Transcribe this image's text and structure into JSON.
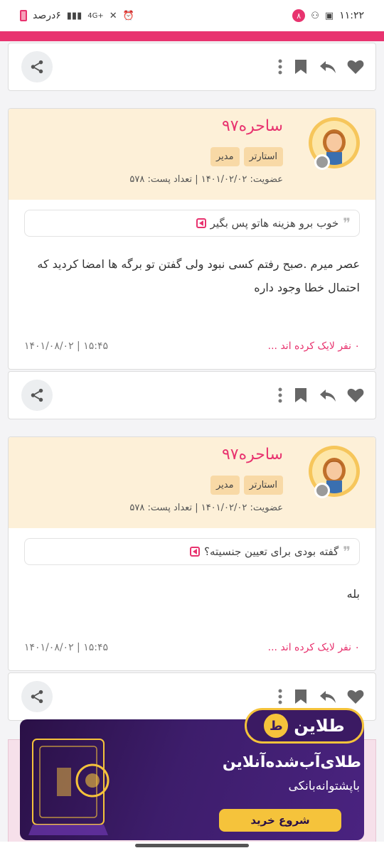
{
  "status": {
    "time": "۱۱:۲۲",
    "notif_count": "۸",
    "network": "4G+",
    "battery": "۶درصد"
  },
  "posts": [
    {
      "username": "ساحره۹۷",
      "badges": [
        "استارتر",
        "مدیر"
      ],
      "meta": "عضویت: ۱۴۰۱/۰۲/۰۲ | تعداد پست: ۵۷۸",
      "quote": "خوب برو هزینه هاتو پس بگیر",
      "body": "عصر میرم .صبح رفتم کسی نبود ولی گفتن تو برگه ها امضا کردید که احتمال خطا وجود داره",
      "likes": "۰ نفر لایک کرده اند ...",
      "date": "۱۵:۴۵ | ۱۴۰۱/۰۸/۰۲"
    },
    {
      "username": "ساحره۹۷",
      "badges": [
        "استارتر",
        "مدیر"
      ],
      "meta": "عضویت: ۱۴۰۱/۰۲/۰۲ | تعداد پست: ۵۷۸",
      "quote": "گفته بودی برای تعیین جنسیته؟",
      "body": "بله",
      "likes": "۰ نفر لایک کرده اند ...",
      "date": "۱۵:۴۵ | ۱۴۰۱/۰۸/۰۲"
    }
  ],
  "ad": {
    "brand": "طلاین",
    "title": "طلای‌آب‌شده‌آنلاین",
    "subtitle": "باپشتوانه‌بانکی",
    "cta": "شروع خرید",
    "brand_color": "#f5c33b"
  },
  "icons": [
    "share-icon",
    "more-vertical-icon",
    "bookmark-icon",
    "reply-icon",
    "heart-icon"
  ]
}
